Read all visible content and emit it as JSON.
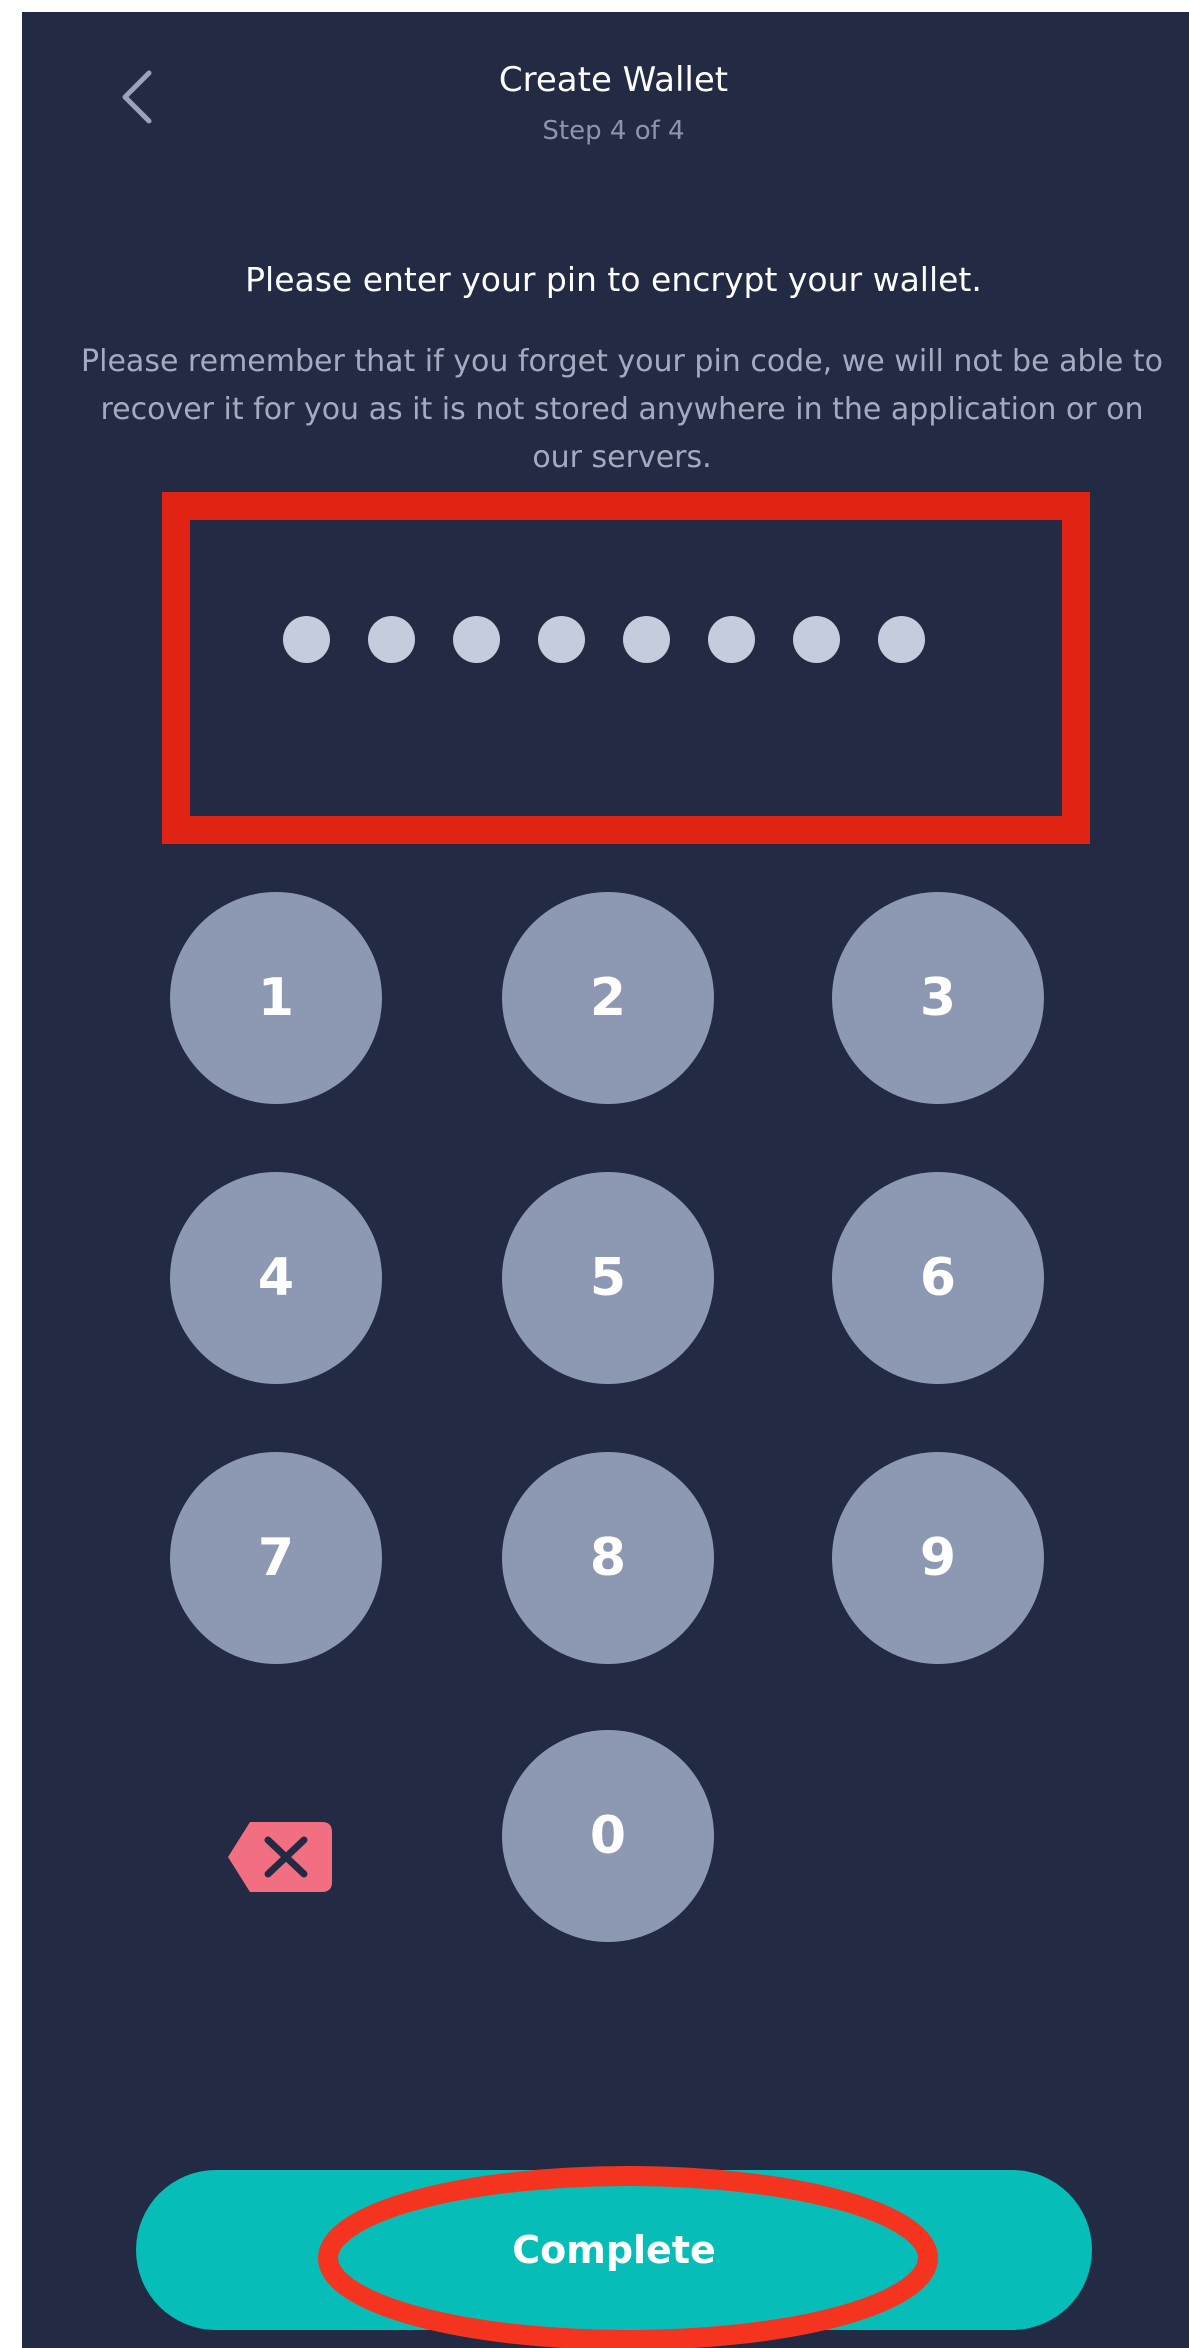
{
  "header": {
    "title": "Create Wallet",
    "subtitle": "Step 4 of 4"
  },
  "content": {
    "instruction": "Please enter your pin to encrypt your wallet.",
    "note": "Please remember that if you forget your pin code, we will not be able to recover it for you as it is not stored anywhere in the application or on our servers."
  },
  "pin": {
    "entered_length": 8
  },
  "keypad": {
    "keys": [
      "1",
      "2",
      "3",
      "4",
      "5",
      "6",
      "7",
      "8",
      "9",
      "0"
    ]
  },
  "footer": {
    "complete_label": "Complete"
  },
  "colors": {
    "background": "#222a44",
    "key": "#8d98b2",
    "accent": "#07bdb8",
    "backspace": "#f16f80",
    "annotation": "#e12313"
  }
}
